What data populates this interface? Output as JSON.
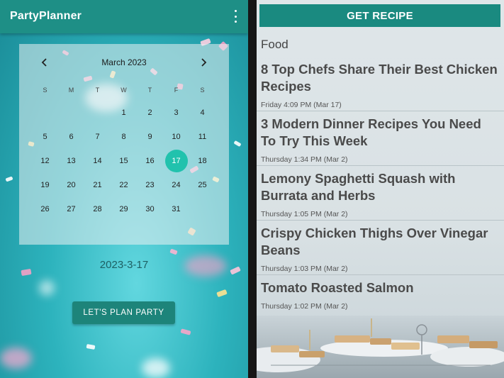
{
  "left_app": {
    "title": "PartyPlanner",
    "calendar": {
      "month_label": "March 2023",
      "weekdays": [
        "S",
        "M",
        "T",
        "W",
        "T",
        "F",
        "S"
      ],
      "weeks": [
        [
          "",
          "",
          "",
          "1",
          "2",
          "3",
          "4"
        ],
        [
          "5",
          "6",
          "7",
          "8",
          "9",
          "10",
          "11"
        ],
        [
          "12",
          "13",
          "14",
          "15",
          "16",
          "17",
          "18"
        ],
        [
          "19",
          "20",
          "21",
          "22",
          "23",
          "24",
          "25"
        ],
        [
          "26",
          "27",
          "28",
          "29",
          "30",
          "31",
          ""
        ]
      ],
      "selected_day": "17"
    },
    "chosen_date": "2023-3-17",
    "plan_button_label": "LET'S PLAN PARTY"
  },
  "right_app": {
    "get_recipe_label": "GET RECIPE",
    "category": "Food",
    "articles": [
      {
        "title": "8 Top Chefs Share Their Best Chicken Recipes",
        "time": "Friday 4:09 PM (Mar 17)"
      },
      {
        "title": "3 Modern Dinner Recipes You Need To Try This Week",
        "time": "Thursday 1:34 PM (Mar 2)"
      },
      {
        "title": "Lemony Spaghetti Squash with Burrata and Herbs",
        "time": "Thursday 1:05 PM (Mar 2)"
      },
      {
        "title": "Crispy Chicken Thighs Over Vinegar Beans",
        "time": "Thursday 1:03 PM (Mar 2)"
      },
      {
        "title": "Tomato Roasted Salmon",
        "time": "Thursday 1:02 PM (Mar 2)"
      }
    ]
  },
  "colors": {
    "appbar": "#1e8f86",
    "selected_day": "#21c2ad",
    "plan_button": "#1d847a",
    "get_recipe_button": "#1a8a80"
  },
  "icons": [
    "overflow-menu-icon",
    "chevron-left-icon",
    "chevron-right-icon"
  ]
}
